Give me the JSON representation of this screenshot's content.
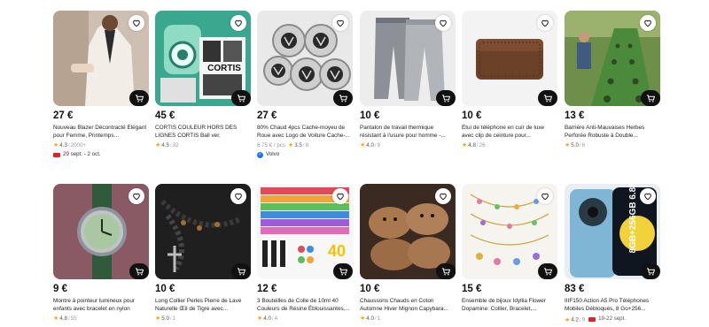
{
  "products_row1": [
    {
      "price": "27 €",
      "title": "Nouveau Blazer Décontracté Élégant pour Femme, Printemps...",
      "rating": "4.3",
      "reviews": "2000+",
      "shipping": "29 sept. - 2 oct."
    },
    {
      "price": "45 €",
      "title": "CORTIS COULEUR HORS DES LIGNES CORTIS Ball ver.",
      "rating": "4.5",
      "reviews": "32",
      "image_text": "CORTIS"
    },
    {
      "price": "27 €",
      "title": "80% Chaud 4pcs Cache-moyeu de Roue avec Logo de Voiture Cache-...",
      "unit_price": "6.75 € / pcs",
      "rating": "3.5",
      "reviews": "8",
      "brand": "Volvo"
    },
    {
      "price": "10 €",
      "title": "Pantalon de travail thermique résistant à l'usure pour homme -...",
      "rating": "4.0",
      "reviews": "9"
    },
    {
      "price": "10 €",
      "title": "Étui de téléphone en cuir de luxe avec clip de ceinture pour...",
      "rating": "4.8",
      "reviews": "26"
    },
    {
      "price": "13 €",
      "title": "Barrière Anti-Mauvaises Herbes Perforée Robuste à Double...",
      "rating": "5.0",
      "reviews": "6"
    }
  ],
  "products_row2": [
    {
      "price": "9 €",
      "title": "Montre à pointeur lumineux pour enfants avec bracelet en nylon",
      "rating": "4.8",
      "reviews": "55"
    },
    {
      "price": "10 €",
      "title": "Long Collier Perles Pierre de Lave Naturelle Œil de Tigre avec...",
      "rating": "5.0",
      "reviews": "1"
    },
    {
      "price": "12 €",
      "title": "3 Bouteilles de Colle de 10ml 40 Couleurs de Résine Éblouissantes,...",
      "rating": "4.0",
      "reviews": "4",
      "image_text": "40"
    },
    {
      "price": "10 €",
      "title": "Chaussons Chauds en Coton Automne Hiver Mignon Capybara...",
      "rating": "4.0",
      "reviews": "1"
    },
    {
      "price": "15 €",
      "title": "Ensemble de bijoux Idyllia Flower Dopamine: Collier, Bracelet,...",
      "rating": "",
      "reviews": ""
    },
    {
      "price": "83 €",
      "title": "IIIF150 Action A5 Pro Téléphones Mobiles Débloqués, 8 Go+256...",
      "rating": "4.2",
      "reviews": "9",
      "shipping": "19-22 sept.",
      "image_text": "8GB+256GB 6.88\""
    }
  ],
  "colors": {
    "star": "#f5a623",
    "truck": "#e02424",
    "brand_check": "#1a73e8",
    "cart_button": "#111111"
  },
  "icons": {
    "favorite": "heart-outline-icon",
    "cart": "shopping-cart-icon",
    "rating": "star-icon",
    "shipping": "truck-icon",
    "brand": "check-badge-icon"
  }
}
